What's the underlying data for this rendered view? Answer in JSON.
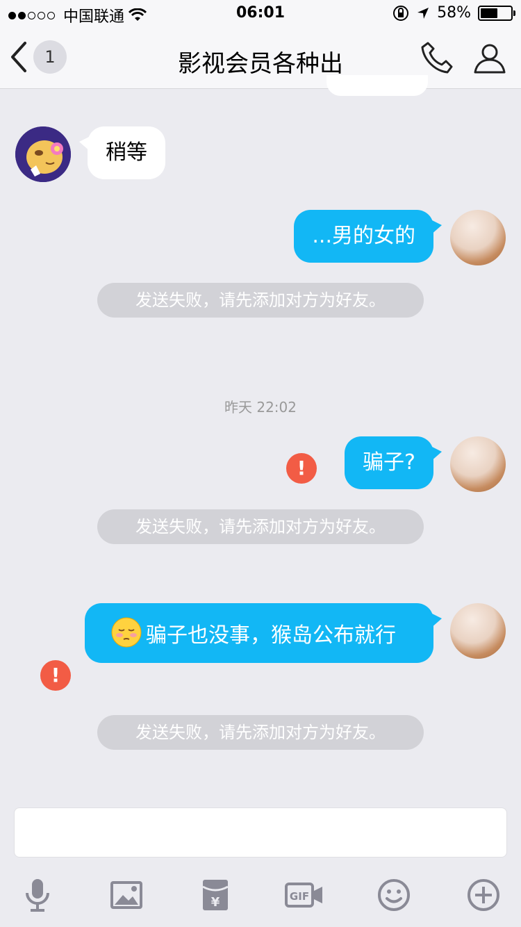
{
  "status": {
    "carrier": "中国联通",
    "time": "06:01",
    "battery": "58%",
    "battery_level": 0.58
  },
  "nav": {
    "back_count": "1",
    "title": "影视会员各种出"
  },
  "messages": {
    "m1": "稍等",
    "m2": "...男的女的",
    "fail1": "发送失败，请先添加对方为好友。",
    "timestamp": "昨天 22:02",
    "m3": "骗子?",
    "fail2": "发送失败，请先添加对方为好友。",
    "m4": "骗子也没事，猴岛公布就行",
    "fail3": "发送失败，请先添加对方为好友。"
  },
  "input": {
    "value": ""
  },
  "toolbar": [
    "mic-icon",
    "image-icon",
    "red-packet-icon",
    "gif-icon",
    "emoji-icon",
    "plus-icon"
  ],
  "colors": {
    "bubble_me": "#12b7f5",
    "error": "#f25c45",
    "background": "#ebebf0"
  }
}
